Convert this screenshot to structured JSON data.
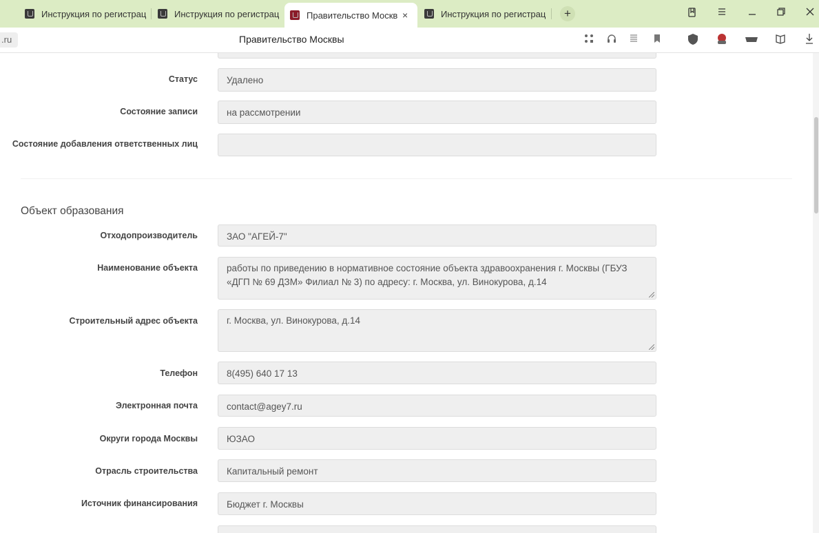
{
  "browser": {
    "tabs": [
      {
        "label": "Инструкция по регистрац",
        "active": false
      },
      {
        "label": "Инструкция по регистрац",
        "active": false
      },
      {
        "label": "Правительство Москвы",
        "active": true,
        "close": "×"
      },
      {
        "label": "Инструкция по регистрац",
        "active": false
      }
    ],
    "new_tab": "+",
    "url_fragment": ".ru",
    "page_title": "Правительство Москвы"
  },
  "form": {
    "top_fields": [
      {
        "label": "Статус",
        "value": "Удалено"
      },
      {
        "label": "Состояние записи",
        "value": "на рассмотрении"
      },
      {
        "label": "Состояние добавления ответственных лиц",
        "value": ""
      }
    ],
    "section_title": "Объект образования",
    "section_fields": [
      {
        "label": "Отходопроизводитель",
        "value": "ЗАО \"АГЕЙ-7\""
      },
      {
        "label": "Наименование объекта",
        "value": "работы по приведению в нормативное состояние объекта здравоохранения г. Москвы (ГБУЗ «ДГП № 69 ДЗМ» Филиал № 3) по адресу: г. Москва, ул. Винокурова, д.14"
      },
      {
        "label": "Строительный адрес объекта",
        "value": "г. Москва, ул. Винокурова, д.14"
      },
      {
        "label": "Телефон",
        "value": "8(495) 640 17 13"
      },
      {
        "label": "Электронная почта",
        "value": "contact@agey7.ru"
      },
      {
        "label": "Округи города Москвы",
        "value": "ЮЗАО"
      },
      {
        "label": "Отрасль строительства",
        "value": "Капитальный ремонт"
      },
      {
        "label": "Источник финансирования",
        "value": "Бюджет г. Москвы"
      }
    ]
  }
}
